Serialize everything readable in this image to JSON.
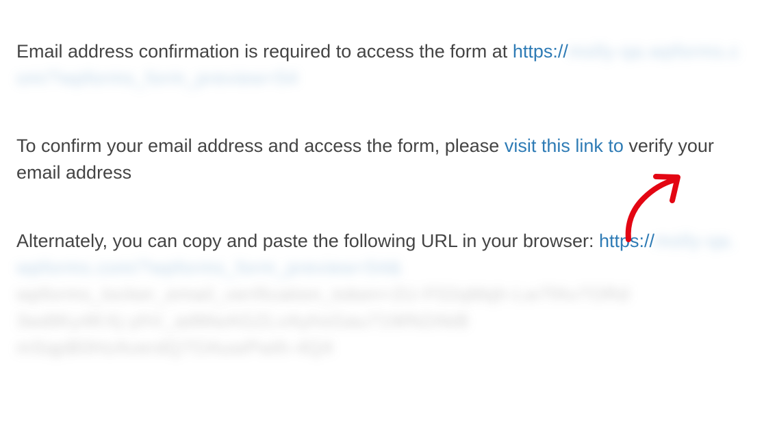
{
  "paragraph1": {
    "text": "Email address confirmation is required to access the form at ",
    "link_prefix": "https://",
    "blurred_url": "molly-qa.wpforms.com/?wpforms_form_preview=54"
  },
  "paragraph2": {
    "text_before": "To confirm your email address and access the form, please ",
    "link_text": "visit this link to",
    "text_after": " verify your email address"
  },
  "paragraph3": {
    "text": "Alternately, you can copy and paste the following URL in your browser: ",
    "link_prefix": "https://",
    "blurred_line1": "molly-qa.wpforms.com/?wpforms_form_preview=54&",
    "blurred_line2": "wpforms_locker_email_verification_token=2U-F02qMqh-Lw7fAv7ORd",
    "blurred_line3": "3wdtKy4KXj-yhV_adMwAGZLvAyhsGau71WN2AkB",
    "blurred_line4": "mSqpB0HzAverdQ7OAuwPwth-4Q4"
  }
}
